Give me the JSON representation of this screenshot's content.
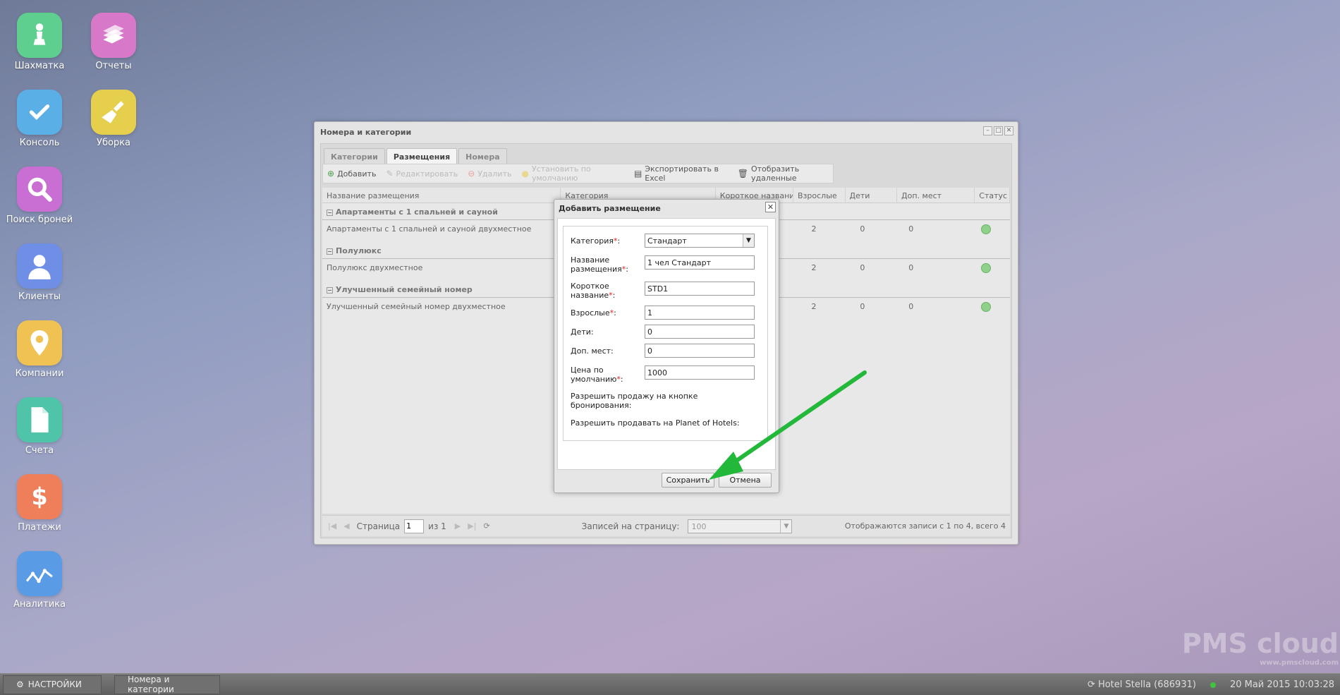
{
  "desktop": {
    "icons": [
      {
        "label": "Шахматка",
        "color": "#5fcf8f",
        "icon": "chess-pawn-icon"
      },
      {
        "label": "Отчеты",
        "color": "#d878c8",
        "icon": "books-icon"
      },
      {
        "label": "Консоль",
        "color": "#5ab0e6",
        "icon": "checkmark-icon"
      },
      {
        "label": "Уборка",
        "color": "#e6cf4c",
        "icon": "broom-icon"
      },
      {
        "label": "Поиск броней",
        "color": "#c96fd4",
        "icon": "magnifier-icon"
      },
      {
        "label": "Клиенты",
        "color": "#6f8ee6",
        "icon": "person-icon"
      },
      {
        "label": "Компании",
        "color": "#f0c254",
        "icon": "map-pin-icon"
      },
      {
        "label": "Счета",
        "color": "#4fc4a8",
        "icon": "document-icon"
      },
      {
        "label": "Платежи",
        "color": "#ef7f5a",
        "icon": "dollar-icon"
      },
      {
        "label": "Аналитика",
        "color": "#5a9be6",
        "icon": "chart-line-icon"
      }
    ]
  },
  "window": {
    "title": "Номера и категории",
    "tabs": [
      {
        "label": "Категории",
        "active": false
      },
      {
        "label": "Размещения",
        "active": true
      },
      {
        "label": "Номера",
        "active": false
      }
    ],
    "toolbar": {
      "add": "Добавить",
      "edit": "Редактировать",
      "delete": "Удалить",
      "set_default": "Установить по умолчанию",
      "export": "Экспортировать в Excel",
      "show_deleted": "Отобразить удаленные"
    },
    "columns": [
      "Название размещения",
      "Категория",
      "Короткое название",
      "Взрослые",
      "Дети",
      "Доп. мест",
      "Статус"
    ],
    "groups": [
      {
        "name": "Апартаменты с 1 спальней и сауной",
        "row": {
          "name": "Апартаменты с 1 спальней и сауной двухместное",
          "adults": "2",
          "children": "0",
          "extra": "0"
        }
      },
      {
        "name": "Полулюкс",
        "row": {
          "name": "Полулюкс двухместное",
          "adults": "2",
          "children": "0",
          "extra": "0"
        }
      },
      {
        "name": "Улучшенный семейный номер",
        "row": {
          "name": "Улучшенный семейный номер двухместное",
          "adults": "2",
          "children": "0",
          "extra": "0"
        }
      }
    ],
    "pager": {
      "page_label": "Страница",
      "page_value": "1",
      "of_label": "из 1",
      "per_page_label": "Записей на страницу:",
      "per_page_value": "100",
      "summary": "Отображаются записи с 1 по 4, всего 4"
    }
  },
  "modal": {
    "title": "Добавить размещение",
    "fields": {
      "category_label": "Категория",
      "category_value": "Стандарт",
      "name_label": "Название размещения",
      "name_value": "1 чел Стандарт",
      "short_label": "Короткое название",
      "short_value": "STD1",
      "adults_label": "Взрослые",
      "adults_value": "1",
      "children_label": "Дети:",
      "children_value": "0",
      "extra_label": "Доп. мест:",
      "extra_value": "0",
      "price_label": "Цена по умолчанию",
      "price_value": "1000",
      "allow_booking_label": "Разрешить продажу на кнопке бронирования:",
      "allow_planet_label": "Разрешить продавать на Planet of Hotels:"
    },
    "save": "Сохранить",
    "cancel": "Отмена"
  },
  "taskbar": {
    "settings": "НАСТРОЙКИ",
    "open_window": "Номера и категории",
    "hotel": "Hotel Stella (686931)",
    "datetime": "20 Май 2015 10:03:28"
  },
  "watermark": {
    "brand": "PMS cloud",
    "url": "www.pmscloud.com"
  },
  "arrow_color": "#22b83a"
}
